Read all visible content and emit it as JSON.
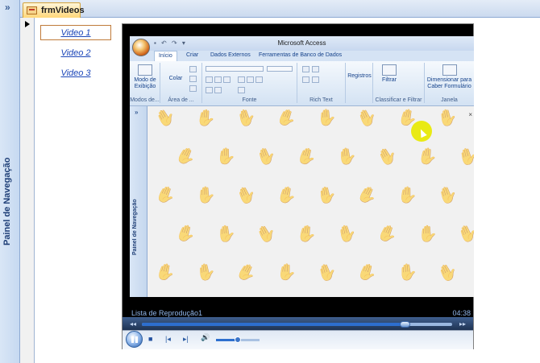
{
  "nav_pane": {
    "label": "Painel de Navegação",
    "expand_glyph": "»"
  },
  "tab": {
    "label": "frmVideos",
    "icon": "form-icon"
  },
  "record_selector": {
    "glyph": "current-record-arrow"
  },
  "video_links": [
    {
      "label": "Video 1",
      "selected": true
    },
    {
      "label": "Video 2",
      "selected": false
    },
    {
      "label": "Video 3",
      "selected": false
    }
  ],
  "player": {
    "playlist_label": "Lista de Reprodução1",
    "time": "04:38",
    "seek_progress": 0.85,
    "volume_level": 0.5,
    "embedded_app": {
      "title": "Microsoft Access",
      "tabs": [
        "Início",
        "Criar",
        "Dados Externos",
        "Ferramentas de Banco de Dados"
      ],
      "ribbon": {
        "view_button": "Modo de Exibição",
        "paste_button": "Colar",
        "records_button": "Registros",
        "filter_button": "Filtrar",
        "resize_button": "Dimensionar para Caber Formulário",
        "groups": [
          "Modos de...",
          "Área de ...",
          "Fonte",
          "Rich Text",
          "Classificar e Filtrar",
          "Janela"
        ]
      },
      "nav_pane_label": "Painel de Navegação",
      "nav_expand_glyph": "»",
      "close_glyph": "×"
    }
  },
  "colors": {
    "accent": "#1d47b8",
    "tab_bg": "#ffd77a",
    "seek_fill": "#2d6fcf"
  }
}
